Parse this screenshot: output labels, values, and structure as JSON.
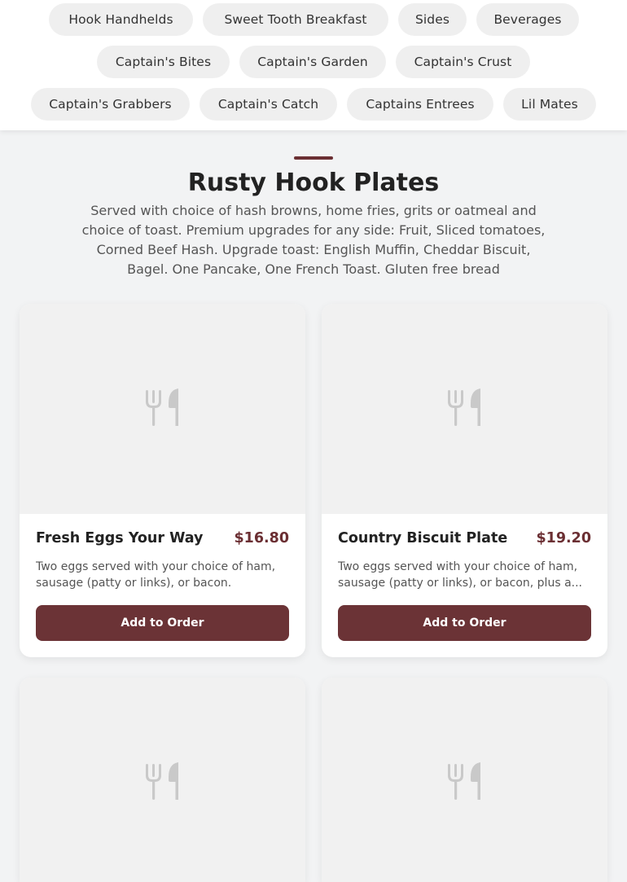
{
  "category_nav": {
    "chips": [
      "Hook Handhelds",
      "Sweet Tooth Breakfast",
      "Sides",
      "Beverages",
      "Captain's Bites",
      "Captain's Garden",
      "Captain's Crust",
      "Captain's Grabbers",
      "Captain's Catch",
      "Captains Entrees",
      "Lil Mates"
    ]
  },
  "section": {
    "title": "Rusty Hook Plates",
    "description": "Served with choice of hash browns, home fries, grits or oatmeal and choice of toast. Premium upgrades for any side: Fruit, Sliced tomatoes, Corned Beef Hash. Upgrade toast: English Muffin, Cheddar Biscuit, Bagel. One Pancake, One French Toast. Gluten free bread"
  },
  "menu_items": [
    {
      "name": "Fresh Eggs Your Way",
      "price": "$16.80",
      "description": "Two eggs served with your choice of ham, sausage (patty or links), or bacon.",
      "button_label": "Add to Order",
      "image_icon": "utensils-icon"
    },
    {
      "name": "Country Biscuit Plate",
      "price": "$19.20",
      "description": "Two eggs served with your choice of ham, sausage (patty or links), or bacon, plus a...",
      "button_label": "Add to Order",
      "image_icon": "utensils-icon"
    },
    {
      "image_icon": "utensils-icon"
    },
    {
      "image_icon": "utensils-icon"
    }
  ],
  "colors": {
    "accent": "#6b2f33",
    "button": "#6b3336",
    "chip_bg": "#efefef",
    "page_bg": "#f2f3f4"
  }
}
